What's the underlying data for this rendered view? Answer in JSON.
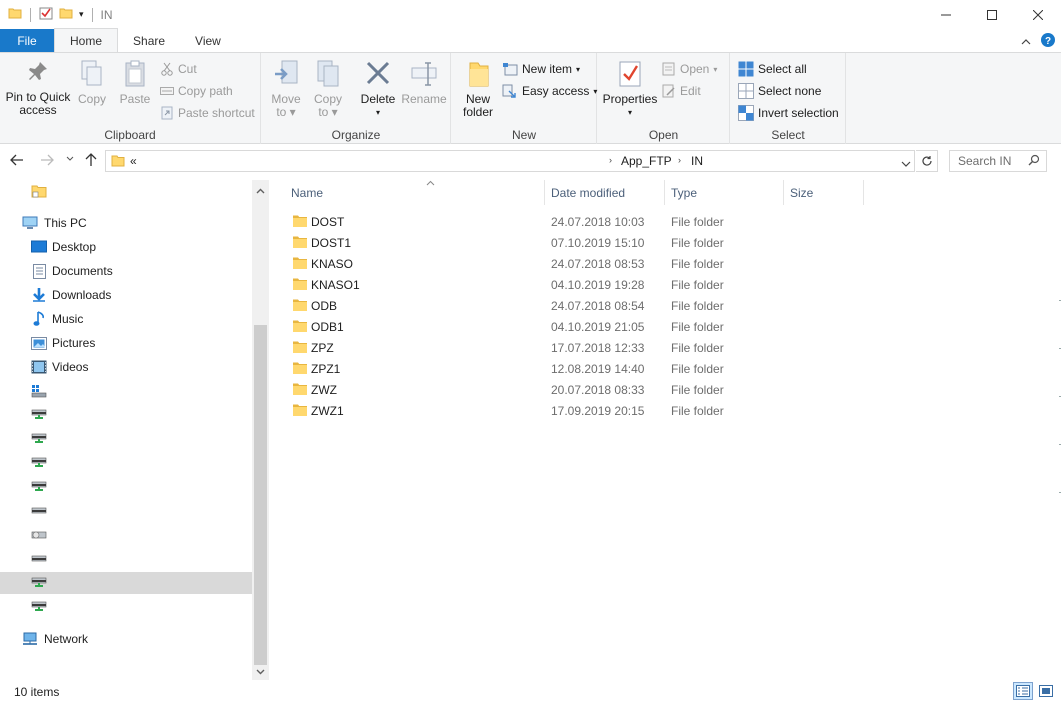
{
  "window": {
    "title": "IN",
    "controls": [
      "minimize",
      "maximize",
      "close"
    ]
  },
  "ribbon_tabs": [
    {
      "label": "File"
    },
    {
      "label": "Home"
    },
    {
      "label": "Share"
    },
    {
      "label": "View"
    }
  ],
  "ribbon": {
    "clipboard": {
      "label": "Clipboard",
      "pin": "Pin to Quick access",
      "pin_line1": "Pin to Quick",
      "pin_line2": "access",
      "copy": "Copy",
      "paste": "Paste",
      "cut": "Cut",
      "copy_path": "Copy path",
      "paste_shortcut": "Paste shortcut"
    },
    "organize": {
      "label": "Organize",
      "move_to": "Move",
      "move_to2": "to",
      "copy_to": "Copy",
      "copy_to2": "to",
      "delete": "Delete",
      "rename": "Rename"
    },
    "new": {
      "label": "New",
      "new_folder1": "New",
      "new_folder2": "folder",
      "new_item": "New item",
      "easy_access": "Easy access"
    },
    "open": {
      "label": "Open",
      "properties": "Properties",
      "open": "Open",
      "edit": "Edit"
    },
    "select": {
      "label": "Select",
      "select_all": "Select all",
      "select_none": "Select none",
      "invert": "Invert selection"
    }
  },
  "address": {
    "overflow": "«",
    "crumbs": [
      "App_FTP",
      "IN"
    ]
  },
  "search": {
    "placeholder": "Search IN"
  },
  "nav_pane": {
    "this_pc": "This PC",
    "items": [
      {
        "label": "Desktop",
        "icon": "desktop-icon"
      },
      {
        "label": "Documents",
        "icon": "documents-icon"
      },
      {
        "label": "Downloads",
        "icon": "downloads-icon"
      },
      {
        "label": "Music",
        "icon": "music-icon"
      },
      {
        "label": "Pictures",
        "icon": "pictures-icon"
      },
      {
        "label": "Videos",
        "icon": "videos-icon"
      }
    ],
    "network": "Network"
  },
  "columns": {
    "name": "Name",
    "date": "Date modified",
    "type": "Type",
    "size": "Size"
  },
  "files": [
    {
      "name": "DOST",
      "date": "24.07.2018 10:03",
      "type": "File folder"
    },
    {
      "name": "DOST1",
      "date": "07.10.2019 15:10",
      "type": "File folder"
    },
    {
      "name": "KNASO",
      "date": "24.07.2018 08:53",
      "type": "File folder"
    },
    {
      "name": "KNASO1",
      "date": "04.10.2019 19:28",
      "type": "File folder"
    },
    {
      "name": "ODB",
      "date": "24.07.2018 08:54",
      "type": "File folder"
    },
    {
      "name": "ODB1",
      "date": "04.10.2019 21:05",
      "type": "File folder"
    },
    {
      "name": "ZPZ",
      "date": "17.07.2018 12:33",
      "type": "File folder"
    },
    {
      "name": "ZPZ1",
      "date": "12.08.2019 14:40",
      "type": "File folder"
    },
    {
      "name": "ZWZ",
      "date": "20.07.2018 08:33",
      "type": "File folder"
    },
    {
      "name": "ZWZ1",
      "date": "17.09.2019 20:15",
      "type": "File folder"
    }
  ],
  "status": {
    "count": "10 items"
  },
  "colors": {
    "accent": "#1979ca",
    "folder": "#ffd86e",
    "folder_dark": "#e8b640",
    "selection": "#d9d9d9"
  }
}
